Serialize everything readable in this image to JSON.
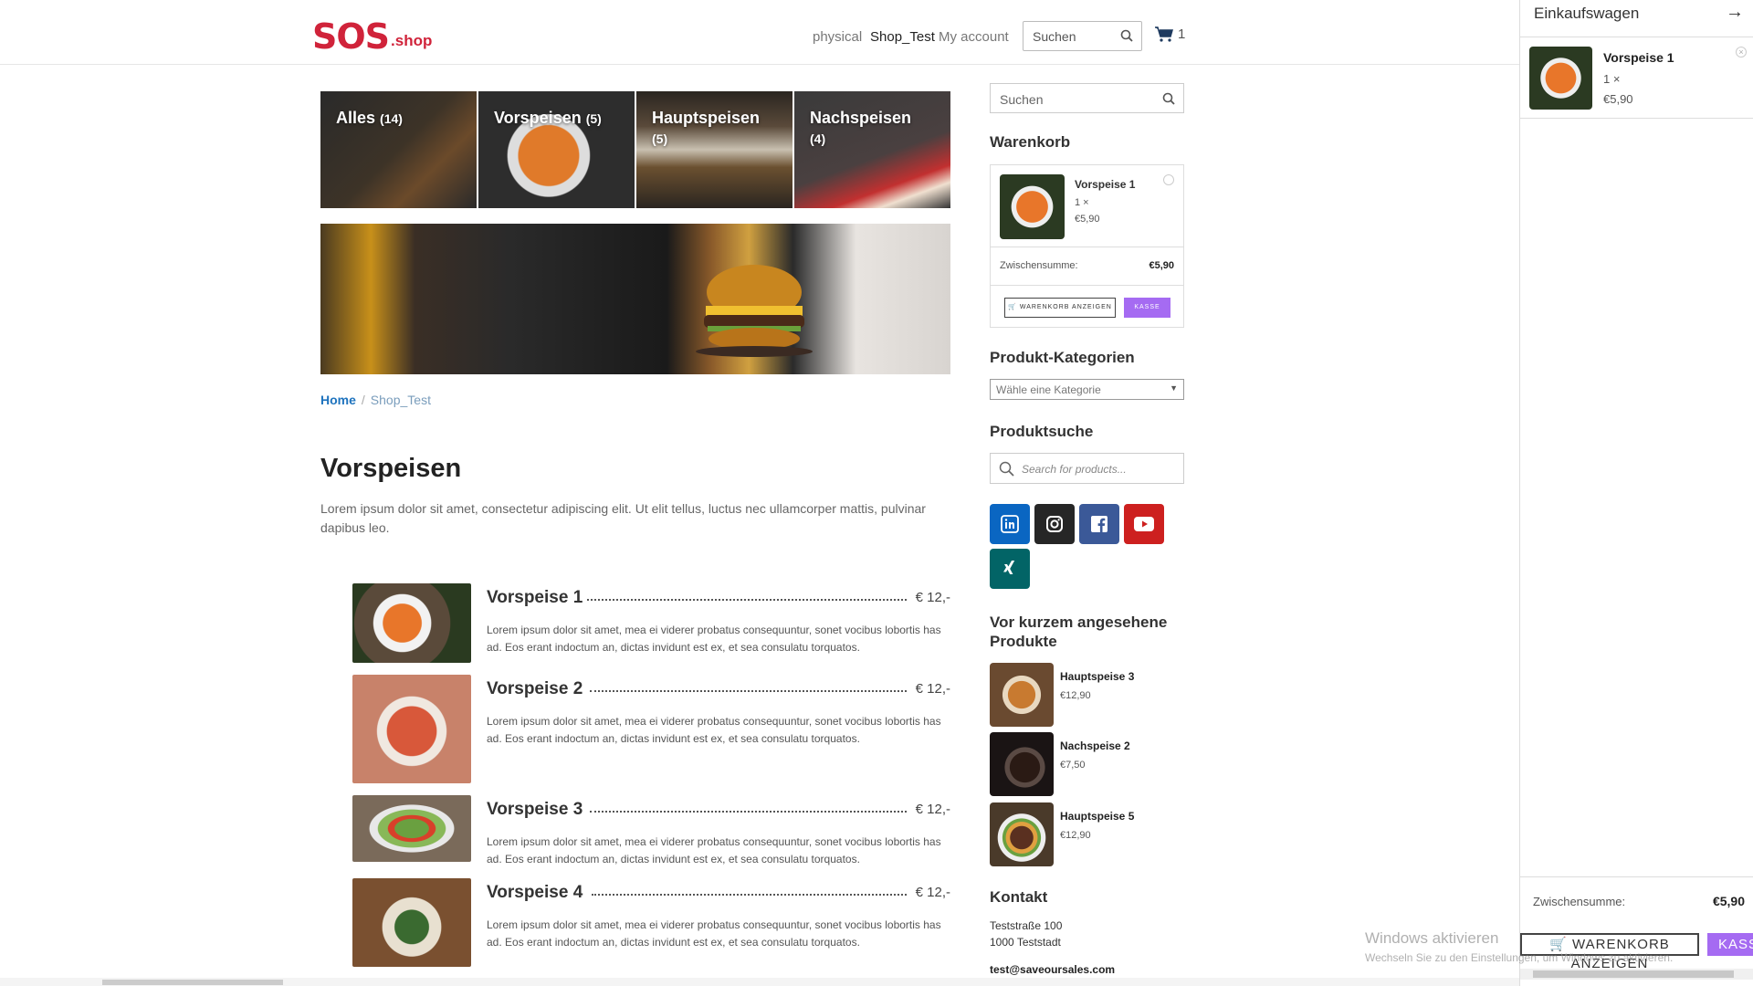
{
  "header": {
    "logo_main": "SOS",
    "logo_sub": ".shop",
    "nav": [
      "physical",
      "Shop_Test",
      "My account"
    ],
    "search_placeholder": "Suchen",
    "cart_count": "1"
  },
  "categories": [
    {
      "name": "Alles",
      "count": "(14)"
    },
    {
      "name": "Vorspeisen",
      "count": "(5)"
    },
    {
      "name": "Hauptspeisen",
      "count": "(5)"
    },
    {
      "name": "Nachspeisen",
      "count": "(4)"
    }
  ],
  "breadcrumb": {
    "home": "Home",
    "sep": "/",
    "current": "Shop_Test"
  },
  "page_title": "Vorspeisen",
  "intro": "Lorem ipsum dolor sit amet, consectetur adipiscing elit. Ut elit tellus, luctus nec ullamcorper mattis, pulvinar dapibus leo.",
  "menu": [
    {
      "title": "Vorspeise 1",
      "price": "€ 12,-",
      "desc": "Lorem ipsum dolor sit amet, mea ei viderer probatus consequuntur, sonet vocibus lobortis has ad. Eos erant indoctum an, dictas invidunt est ex, et sea consulatu torquatos."
    },
    {
      "title": "Vorspeise 2",
      "price": "€ 12,-",
      "desc": "Lorem ipsum dolor sit amet, mea ei viderer probatus consequuntur, sonet vocibus lobortis has ad. Eos erant indoctum an, dictas invidunt est ex, et sea consulatu torquatos."
    },
    {
      "title": "Vorspeise 3",
      "price": "€ 12,-",
      "desc": "Lorem ipsum dolor sit amet, mea ei viderer probatus consequuntur, sonet vocibus lobortis has ad. Eos erant indoctum an, dictas invidunt est ex, et sea consulatu torquatos."
    },
    {
      "title": "Vorspeise 4",
      "price": "€ 12,-",
      "desc": "Lorem ipsum dolor sit amet, mea ei viderer probatus consequuntur, sonet vocibus lobortis has ad. Eos erant indoctum an, dictas invidunt est ex, et sea consulatu torquatos."
    }
  ],
  "sidebar": {
    "search_placeholder": "Suchen",
    "cart_heading": "Warenkorb",
    "cart_item": {
      "name": "Vorspeise 1",
      "qty": "1 ×",
      "price": "€5,90"
    },
    "subtotal_label": "Zwischensumme:",
    "subtotal_value": "€5,90",
    "view_cart": "WARENKORB ANZEIGEN",
    "checkout": "KASSE",
    "categories_heading": "Produkt-Kategorien",
    "categories_select": "Wähle eine Kategorie",
    "product_search_heading": "Produktsuche",
    "product_search_placeholder": "Search for products...",
    "social": [
      {
        "icon": "linkedin-icon",
        "color": "#0a66c2"
      },
      {
        "icon": "instagram-icon",
        "color": "#262626"
      },
      {
        "icon": "facebook-icon",
        "color": "#3b5998"
      },
      {
        "icon": "youtube-icon",
        "color": "#cd201f"
      },
      {
        "icon": "xing-icon",
        "color": "#026466"
      }
    ],
    "recent_heading": "Vor kurzem angesehene Produkte",
    "recent": [
      {
        "name": "Hauptspeise 3",
        "price": "€12,90"
      },
      {
        "name": "Nachspeise 2",
        "price": "€7,50"
      },
      {
        "name": "Hauptspeise 5",
        "price": "€12,90"
      }
    ],
    "contact_heading": "Kontakt",
    "contact_street": "Teststraße 100",
    "contact_city": "1000 Teststadt",
    "contact_email": "test@saveoursales.com"
  },
  "drawer": {
    "title": "Einkaufswagen",
    "item": {
      "name": "Vorspeise 1",
      "qty": "1 ×",
      "price": "€5,90"
    },
    "subtotal_label": "Zwischensumme:",
    "subtotal_value": "€5,90",
    "view_cart": "WARENKORB ANZEIGEN",
    "checkout": "KASSE"
  },
  "watermark": {
    "line1": "Windows aktivieren",
    "line2": "Wechseln Sie zu den Einstellungen, um Windows zu aktivieren."
  },
  "colors": {
    "brand": "#d0233a",
    "accent": "#a56bf2",
    "link": "#1e73be"
  }
}
